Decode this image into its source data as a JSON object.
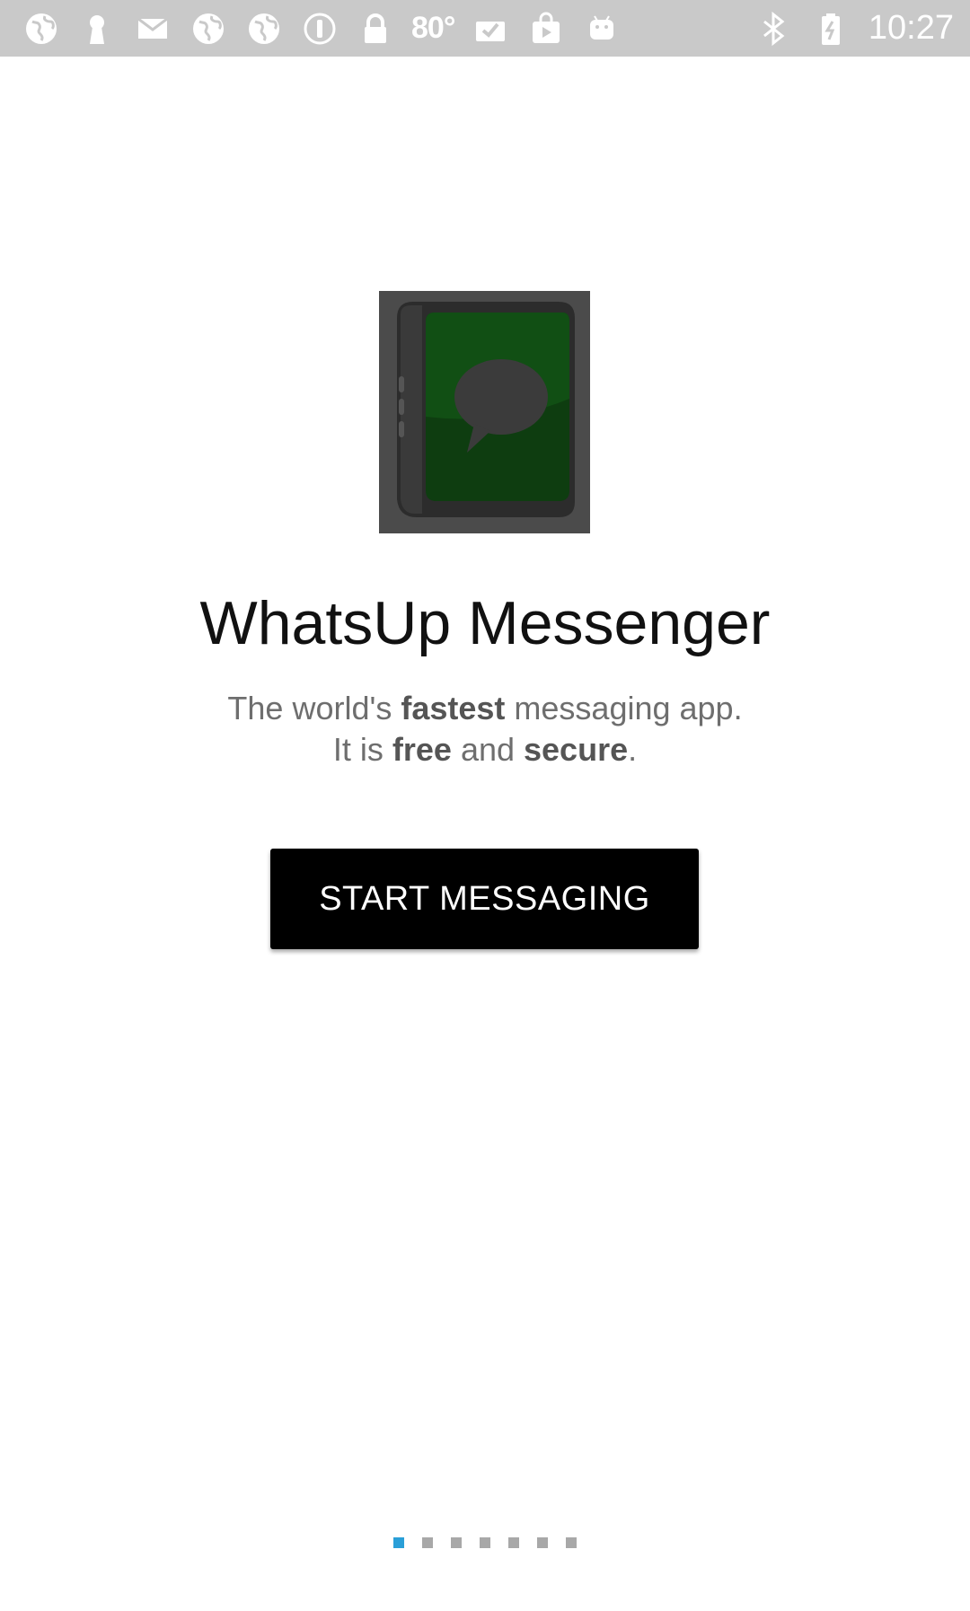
{
  "status_bar": {
    "icons": [
      "globe-icon",
      "keyhole-icon",
      "mail-icon",
      "globe-icon",
      "globe-icon",
      "circle-exclamation-icon",
      "lock-icon"
    ],
    "temperature": "80°",
    "right_icons": [
      "clipboard-check-icon",
      "play-bag-icon",
      "android-icon"
    ],
    "system_icons": [
      "bluetooth-icon",
      "battery-icon"
    ],
    "time": "10:27"
  },
  "logo": {
    "icon": "chat-bubble-device-icon",
    "accent": "#0e5a12"
  },
  "main": {
    "title": "WhatsUp Messenger",
    "subtitle_line1_pre": "The world's ",
    "subtitle_line1_bold": "fastest",
    "subtitle_line1_post": " messaging app.",
    "subtitle_line2_pre": "It is ",
    "subtitle_line2_bold1": "free",
    "subtitle_line2_mid": " and ",
    "subtitle_line2_bold2": "secure",
    "subtitle_line2_post": "."
  },
  "button": {
    "label": "START MESSAGING"
  },
  "pager": {
    "total": 7,
    "active": 0,
    "active_color": "#2a9fd8"
  }
}
